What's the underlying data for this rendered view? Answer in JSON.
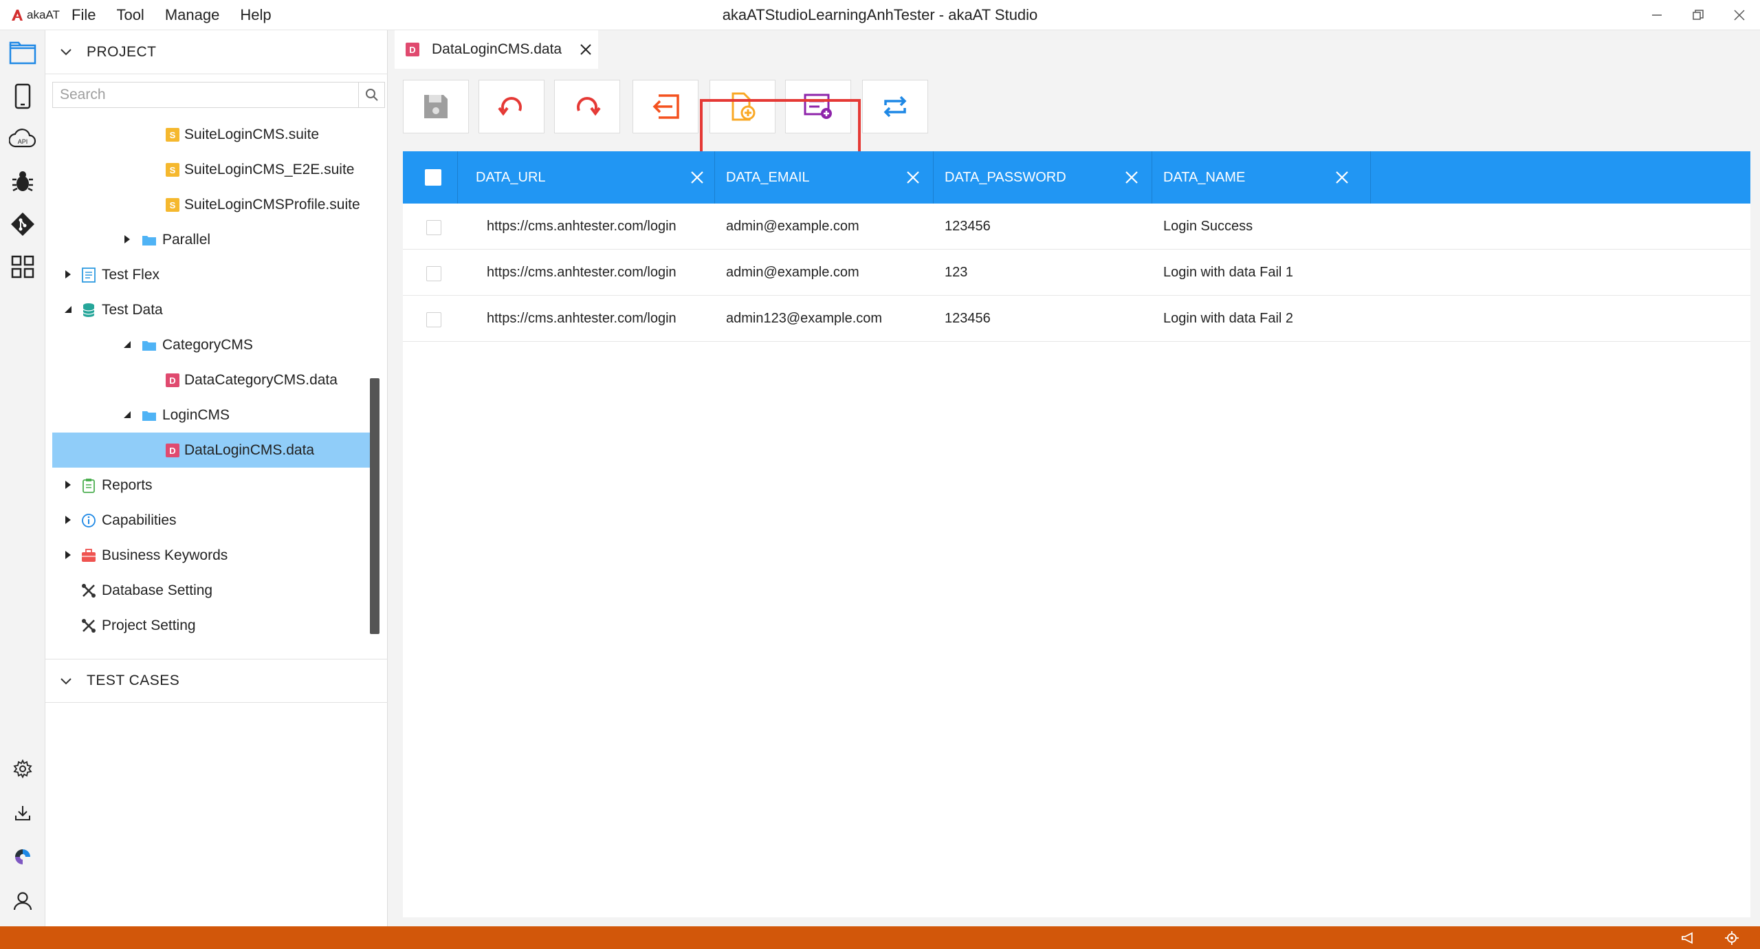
{
  "app": {
    "logo_text": "akaAT",
    "window_title": "akaATStudioLearningAnhTester - akaAT Studio",
    "menu": [
      "File",
      "Tool",
      "Manage",
      "Help"
    ]
  },
  "activity_bar": {
    "top_icons": [
      "explorer-icon",
      "mobile-icon",
      "api-cloud-icon",
      "bug-icon",
      "git-icon",
      "grid-apps-icon"
    ],
    "bottom_icons": [
      "settings-gear-icon",
      "download-icon",
      "plugin-icon",
      "user-icon"
    ]
  },
  "sidebar": {
    "project_header": "PROJECT",
    "search_placeholder": "Search",
    "tree": [
      {
        "label": "SuiteLoginCMS.suite",
        "icon": "S",
        "type": "suite"
      },
      {
        "label": "SuiteLoginCMS_E2E.suite",
        "icon": "S",
        "type": "suite"
      },
      {
        "label": "SuiteLoginCMSProfile.suite",
        "icon": "S",
        "type": "suite"
      },
      {
        "label": "Parallel",
        "type": "folder",
        "expanded": false
      },
      {
        "label": "Test Flex",
        "type": "test-flex",
        "expanded": false
      },
      {
        "label": "Test Data",
        "type": "database",
        "expanded": true
      },
      {
        "label": "CategoryCMS",
        "type": "folder",
        "expanded": true
      },
      {
        "label": "DataCategoryCMS.data",
        "icon": "D",
        "type": "data"
      },
      {
        "label": "LoginCMS",
        "type": "folder",
        "expanded": true
      },
      {
        "label": "DataLoginCMS.data",
        "icon": "D",
        "type": "data",
        "selected": true
      },
      {
        "label": "Reports",
        "type": "reports",
        "expanded": false
      },
      {
        "label": "Capabilities",
        "type": "capabilities",
        "expanded": false
      },
      {
        "label": "Business Keywords",
        "type": "business",
        "expanded": false
      },
      {
        "label": "Database Setting",
        "type": "setting"
      },
      {
        "label": "Project Setting",
        "type": "setting"
      }
    ],
    "test_cases_header": "TEST CASES"
  },
  "editor": {
    "tab": {
      "badge": "D",
      "label": "DataLoginCMS.data"
    },
    "toolbar": [
      {
        "name": "save",
        "icon": "save-icon"
      },
      {
        "name": "undo",
        "icon": "undo-icon"
      },
      {
        "name": "redo",
        "icon": "redo-icon"
      },
      {
        "name": "import",
        "icon": "import-icon"
      },
      {
        "name": "add-column",
        "icon": "add-column-icon",
        "highlighted": true
      },
      {
        "name": "add-row",
        "icon": "add-row-icon",
        "highlighted": true
      },
      {
        "name": "swap",
        "icon": "swap-icon"
      }
    ],
    "grid": {
      "columns": [
        "DATA_URL",
        "DATA_EMAIL",
        "DATA_PASSWORD",
        "DATA_NAME"
      ],
      "rows": [
        [
          "https://cms.anhtester.com/login",
          "admin@example.com",
          "123456",
          "Login Success"
        ],
        [
          "https://cms.anhtester.com/login",
          "admin@example.com",
          "123",
          "Login with data Fail 1"
        ],
        [
          "https://cms.anhtester.com/login",
          "admin123@example.com",
          "123456",
          "Login with data Fail 2"
        ]
      ]
    }
  },
  "colors": {
    "accent": "#2196f3",
    "selection": "#90cdf9",
    "status_bar": "#d2570a",
    "highlight_box": "#e53935"
  }
}
